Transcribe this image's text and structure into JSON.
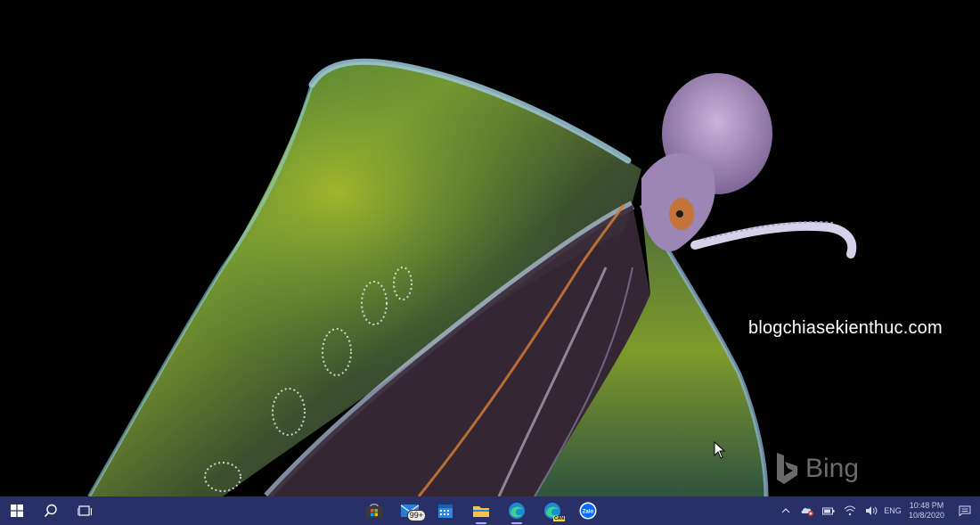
{
  "wallpaper": {
    "watermark_text": "blogchiasekienthuc.com",
    "provider_label": "Bing"
  },
  "taskbar": {
    "left": [
      {
        "name": "start-button",
        "icon": "windows-logo-icon"
      },
      {
        "name": "search-button",
        "icon": "search-icon"
      },
      {
        "name": "task-view-button",
        "icon": "task-view-icon"
      }
    ],
    "apps": [
      {
        "name": "microsoft-store",
        "icon": "store-icon"
      },
      {
        "name": "mail",
        "icon": "mail-icon",
        "badge": "99+"
      },
      {
        "name": "calendar",
        "icon": "calendar-icon"
      },
      {
        "name": "file-explorer",
        "icon": "folder-icon"
      },
      {
        "name": "microsoft-edge",
        "icon": "edge-icon"
      },
      {
        "name": "microsoft-edge-canary",
        "icon": "edge-canary-icon",
        "badge": "CAN"
      },
      {
        "name": "zalo",
        "icon": "zalo-icon",
        "label": "Zalo"
      }
    ],
    "tray": {
      "language": "ENG",
      "time": "10:48 PM",
      "date": "10/8/2020"
    }
  },
  "colors": {
    "taskbar_bg": "#283067",
    "accent": "#9fb3ff"
  }
}
